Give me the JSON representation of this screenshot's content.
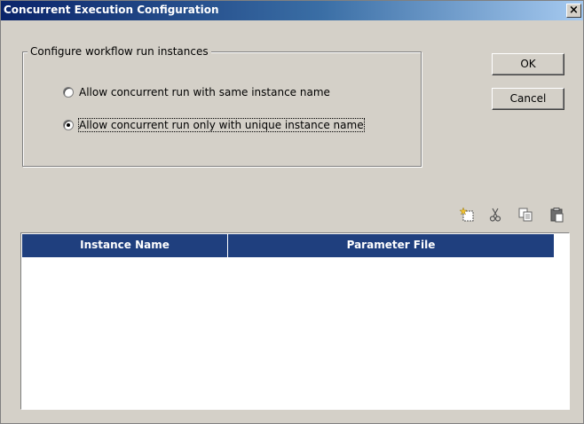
{
  "window": {
    "title": "Concurrent Execution Configuration",
    "close_glyph": "×"
  },
  "group": {
    "legend": "Configure workflow run instances",
    "options": [
      {
        "label": "Allow concurrent run with same instance name",
        "selected": false
      },
      {
        "label": "Allow concurrent run only with unique instance name",
        "selected": true
      }
    ]
  },
  "buttons": {
    "ok": "OK",
    "cancel": "Cancel"
  },
  "toolbar": {
    "icons": [
      "new-row-icon",
      "cut-icon",
      "copy-icon",
      "paste-icon"
    ]
  },
  "table": {
    "columns": [
      "Instance Name",
      "Parameter File"
    ],
    "rows": []
  },
  "colors": {
    "title_bar_start": "#0a246a",
    "title_bar_end": "#a6caf0",
    "table_header": "#1f3f7e",
    "dialog_bg": "#d4d0c8"
  }
}
